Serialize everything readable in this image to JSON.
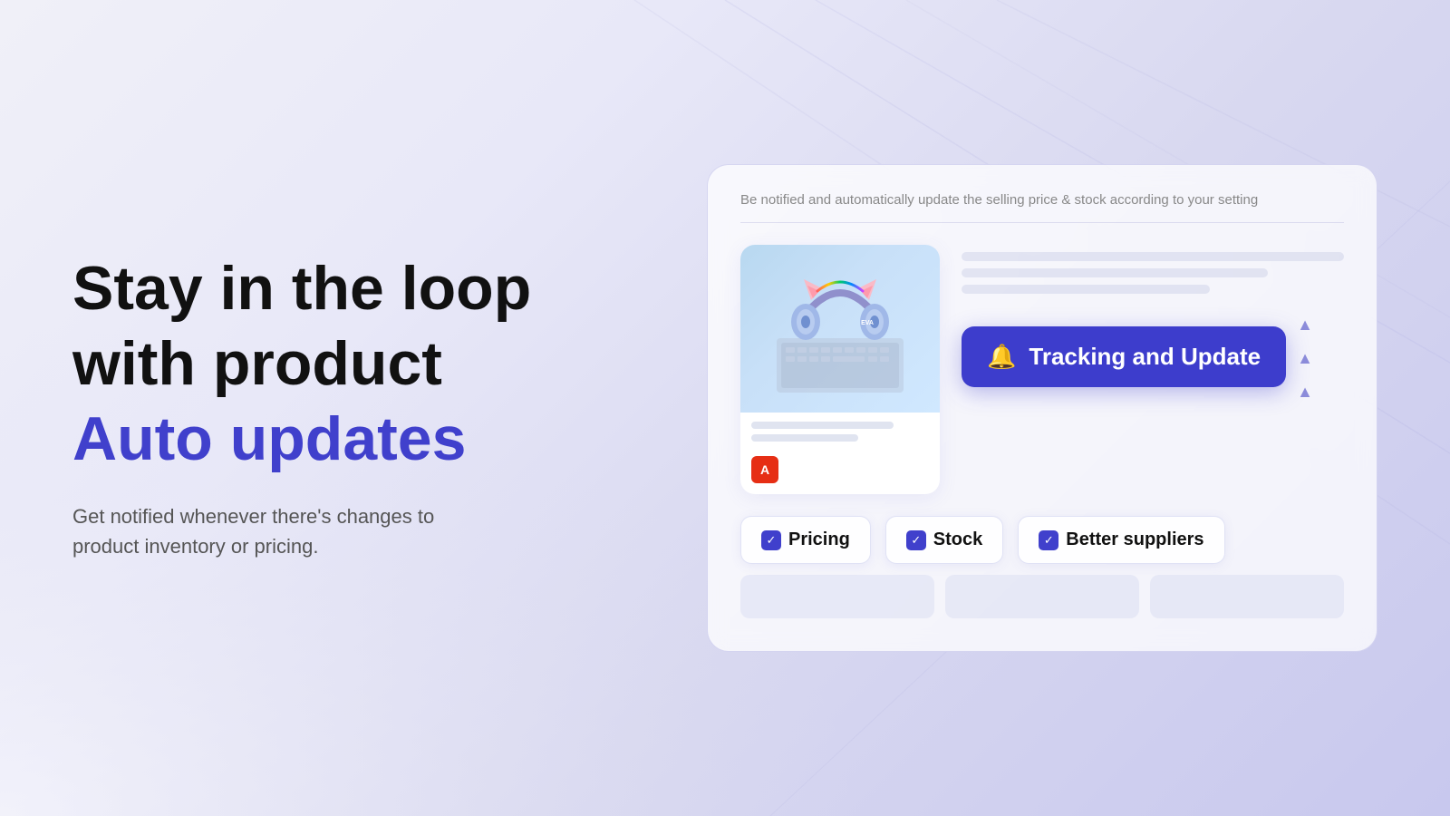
{
  "background": {
    "gradient_start": "#f0f0f8",
    "gradient_end": "#c8c8ee"
  },
  "left": {
    "headline_line1": "Stay in the loop",
    "headline_line2": "with product",
    "headline_accent": "Auto updates",
    "description": "Get notified whenever there's changes to product inventory or pricing."
  },
  "card": {
    "subtitle": "Be notified and automatically update the selling price & stock according to your setting",
    "tracking_button_label": "Tracking and Update",
    "bell_icon": "🔔",
    "checkboxes": [
      {
        "label": "Pricing",
        "checked": true
      },
      {
        "label": "Stock",
        "checked": true
      },
      {
        "label": "Better suppliers",
        "checked": true
      }
    ],
    "aliexpress_letter": "A"
  }
}
